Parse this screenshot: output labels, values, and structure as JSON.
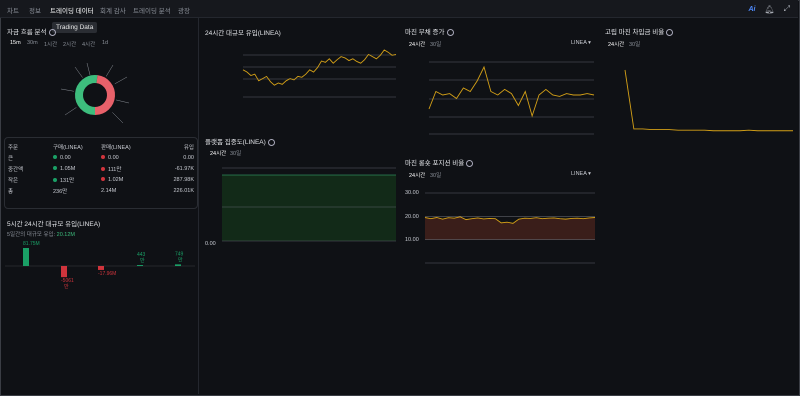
{
  "nav": {
    "tabs": [
      "차트",
      "정보",
      "트레이딩 데이터",
      "회계 감사",
      "트레이딩 분석",
      "광장"
    ],
    "active_tab": "트레이딩 데이터",
    "tooltip": "Trading Data",
    "ai_label": "Ai"
  },
  "fund_flow": {
    "title": "자금 흐름 분석",
    "intervals": [
      "15m",
      "30m",
      "1시간",
      "2시간",
      "4시간",
      "1d"
    ],
    "active_interval": "15m",
    "table": {
      "headers": [
        "주문",
        "구매(LINEA)",
        "판매(LINEA)",
        "유입"
      ],
      "rows": [
        [
          "큰",
          "0.00",
          "0.00",
          "0.00"
        ],
        [
          "중간액",
          "1.05M",
          "111만",
          "-61.97K"
        ],
        [
          "작은",
          "131만",
          "1.02M",
          "287.98K"
        ],
        [
          "총",
          "236만",
          "2.14M",
          "226.01K"
        ]
      ]
    },
    "donut": {
      "buy_ratio": 0.52,
      "colors": {
        "buy": "#3dbd7d",
        "sell": "#e8616a"
      }
    }
  },
  "five_day": {
    "title": "5시간 24시간 대규모 유입(LINEA)",
    "subtitle_label": "5일간의 대규모 유입:",
    "subtitle_value": "20.12M",
    "chart_data": {
      "type": "bar",
      "values": [
        81.75,
        -50.61,
        -17.96,
        4.43,
        7.49
      ],
      "data_labels": [
        "81.75M",
        "-5061\n만",
        "-17.96M",
        "443\n만",
        "749\n만"
      ],
      "colors": [
        "#1aa066",
        "#d0343c",
        "#d0343c",
        "#1aa066",
        "#1aa066"
      ]
    }
  },
  "inflow_24h": {
    "title": "24시간 대규모 유입(LINEA)",
    "chart_data": {
      "type": "line",
      "values": [
        0.55,
        0.5,
        0.42,
        0.45,
        0.3,
        0.35,
        0.4,
        0.28,
        0.2,
        0.25,
        0.22,
        0.3,
        0.35,
        0.32,
        0.4,
        0.38,
        0.45,
        0.55,
        0.5,
        0.6,
        0.75,
        0.72,
        0.8,
        0.7,
        0.78,
        0.85,
        0.82,
        0.76,
        0.8,
        0.74,
        0.7,
        0.78,
        0.9,
        0.85,
        0.8,
        0.88,
        1.0,
        0.95,
        0.88,
        0.9
      ],
      "color": "#d4a017"
    }
  },
  "concentration": {
    "title": "플랫폼 집중도(LINEA)",
    "tabs": [
      "24시간",
      "30일"
    ],
    "active_tab": "24시간",
    "y_label": "0.00"
  },
  "margin_debt": {
    "title": "마진 부채 증가",
    "tabs": [
      "24시간",
      "30일"
    ],
    "active_tab": "24시간",
    "selector": "LINEA",
    "chart_data": {
      "type": "line",
      "values": [
        0.3,
        0.55,
        0.5,
        0.52,
        0.45,
        0.6,
        0.55,
        0.7,
        0.9,
        0.55,
        0.5,
        0.58,
        0.52,
        0.35,
        0.55,
        0.2,
        0.5,
        0.58,
        0.5,
        0.48,
        0.52,
        0.5,
        0.5,
        0.52,
        0.5
      ],
      "color": "#d4a017"
    }
  },
  "long_short": {
    "title": "마진 롱숏 포지션 비율",
    "tabs": [
      "24시간",
      "30일"
    ],
    "active_tab": "24시간",
    "selector": "LINEA",
    "y_ticks": [
      "30.00",
      "20.00",
      "10.00"
    ],
    "chart_data": {
      "type": "area",
      "values": [
        19.5,
        19.0,
        19.5,
        18.8,
        19.4,
        19.2,
        19.8,
        18.6,
        19.0,
        19.3,
        18.9,
        19.1,
        19.0,
        17.2,
        17.5,
        17.0,
        18.8,
        19.2,
        19.1,
        19.4,
        19.0,
        19.2,
        19.3,
        19.0,
        18.8,
        19.1,
        19.2,
        19.0,
        19.3,
        19.5
      ],
      "ylim": [
        0,
        30
      ],
      "color": "#d4a017"
    }
  },
  "isolated_margin": {
    "title": "고립 마진 차입금 비율",
    "tabs": [
      "24시간",
      "30일"
    ],
    "active_tab": "24시간",
    "chart_data": {
      "type": "line",
      "values": [
        1.0,
        0.05,
        0.05,
        0.04,
        0.04,
        0.04,
        0.03,
        0.03,
        0.03,
        0.03,
        0.02,
        0.02,
        0.02,
        0.02,
        0.03,
        0.02,
        0.02,
        0.02,
        0.02,
        0.02
      ],
      "color": "#d4a017"
    }
  }
}
